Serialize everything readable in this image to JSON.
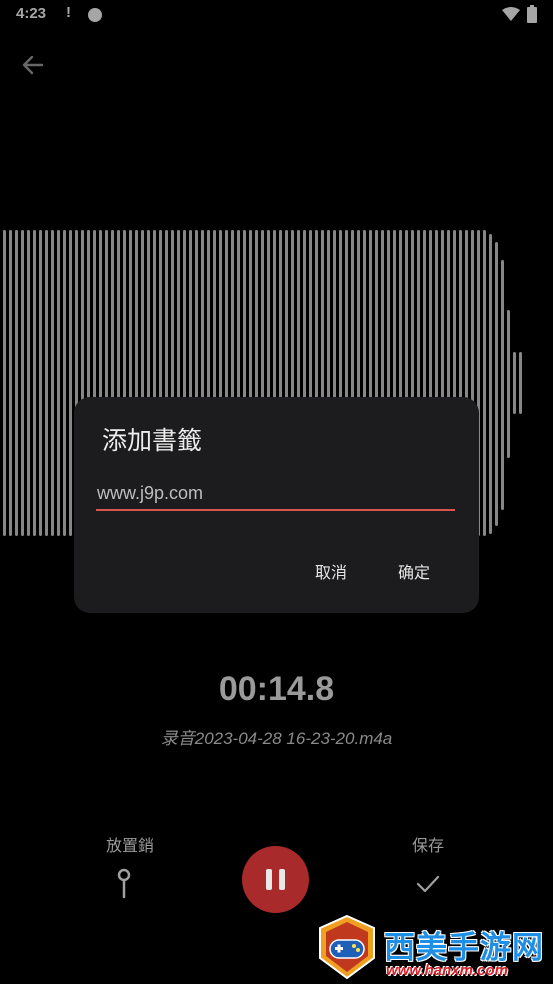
{
  "status_bar": {
    "time": "4:23",
    "alert": "!"
  },
  "dialog": {
    "title": "添加書籤",
    "input_placeholder": "www.j9p.com",
    "cancel_label": "取消",
    "ok_label": "确定",
    "accent_color": "#d9534f"
  },
  "recording": {
    "timer": "00:14.8",
    "filename": "录音2023-04-28 16-23-20.m4a"
  },
  "controls": {
    "pin_label": "放置銷",
    "save_label": "保存",
    "pause_color": "#a82a2a"
  },
  "watermark": {
    "title": "西美手游网",
    "url": "www.hanxm.com"
  },
  "icons": {
    "back": "arrow-left-icon",
    "pin": "pin-icon",
    "pause": "pause-icon",
    "save": "check-icon",
    "wifi": "wifi-icon",
    "battery": "battery-icon"
  }
}
